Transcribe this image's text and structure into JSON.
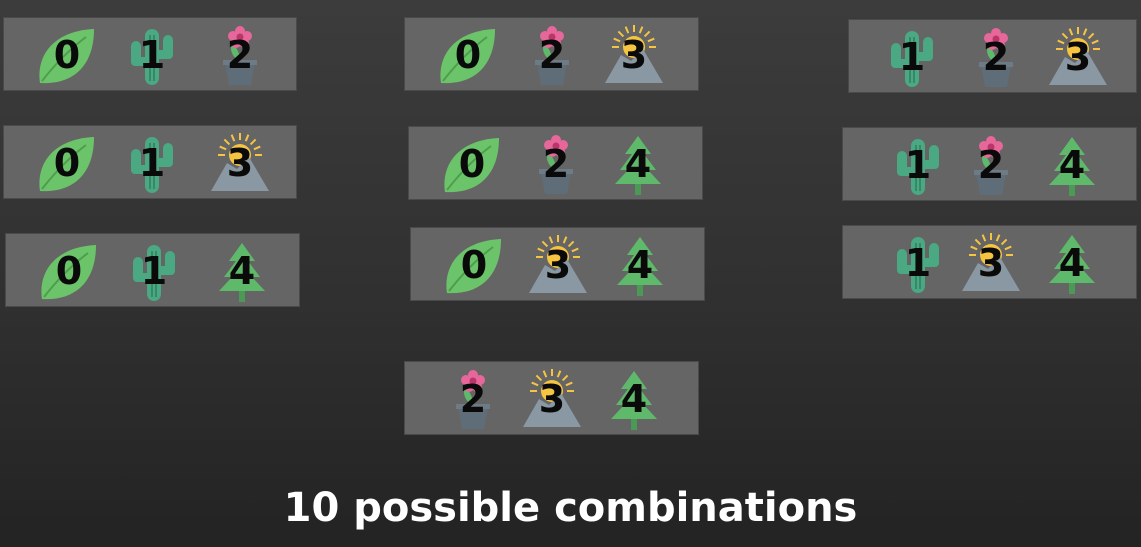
{
  "icons": {
    "0": {
      "name": "leaf-icon",
      "color": "#6cc46a"
    },
    "1": {
      "name": "cactus-icon",
      "color": "#4aa882"
    },
    "2": {
      "name": "potted-flower-icon",
      "color": "#e8679a"
    },
    "3": {
      "name": "mountain-sun-icon",
      "color": "#f5c542"
    },
    "4": {
      "name": "pine-tree-icon",
      "color": "#5fb96a"
    }
  },
  "combinations": [
    {
      "items": [
        "0",
        "1",
        "2"
      ]
    },
    {
      "items": [
        "0",
        "1",
        "3"
      ]
    },
    {
      "items": [
        "0",
        "1",
        "4"
      ]
    },
    {
      "items": [
        "0",
        "2",
        "3"
      ]
    },
    {
      "items": [
        "0",
        "2",
        "4"
      ]
    },
    {
      "items": [
        "0",
        "3",
        "4"
      ]
    },
    {
      "items": [
        "1",
        "2",
        "3"
      ]
    },
    {
      "items": [
        "1",
        "2",
        "4"
      ]
    },
    {
      "items": [
        "1",
        "3",
        "4"
      ]
    },
    {
      "items": [
        "2",
        "3",
        "4"
      ]
    }
  ],
  "caption": "10 possible combinations"
}
